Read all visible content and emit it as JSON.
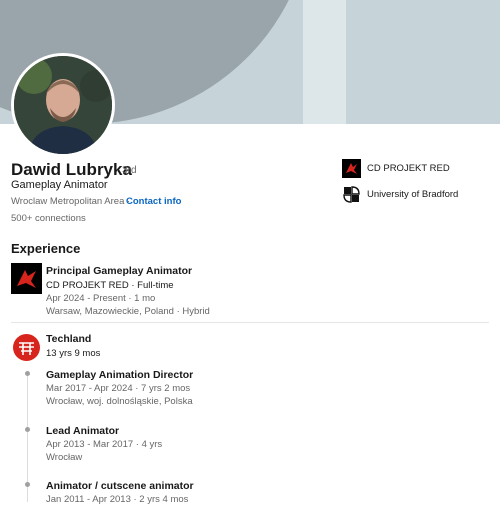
{
  "profile": {
    "name": "Dawid Lubryka",
    "degree": "· 3rd",
    "headline": "Gameplay Animator",
    "location": "Wroclaw Metropolitan Area ·",
    "contact_label": "Contact info",
    "connections": "500+ connections"
  },
  "affiliations": [
    {
      "name": "CD PROJEKT RED",
      "icon": "cdpr-logo-icon"
    },
    {
      "name": "University of Bradford",
      "icon": "university-logo-icon"
    }
  ],
  "experience": {
    "title": "Experience",
    "jobs": [
      {
        "role": "Principal Gameplay Animator",
        "company": "CD PROJEKT RED · Full-time",
        "dates": "Apr 2024 - Present · 1 mo",
        "location": "Warsaw, Mazowieckie, Poland · Hybrid"
      }
    ],
    "groups": [
      {
        "company": "Techland",
        "duration": "13 yrs 9 mos",
        "roles": [
          {
            "title": "Gameplay Animation Director",
            "dates": "Mar 2017 - Apr 2024 · 7 yrs 2 mos",
            "location": "Wrocław, woj. dolnośląskie, Polska"
          },
          {
            "title": "Lead Animator",
            "dates": "Apr 2013 - Mar 2017 · 4 yrs",
            "location": "Wrocław"
          },
          {
            "title": "Animator / cutscene animator",
            "dates": "Jan 2011 - Apr 2013 · 2 yrs 4 mos"
          }
        ]
      }
    ]
  },
  "colors": {
    "link": "#0a66c2",
    "cdpr_red": "#d7251d",
    "techland_red": "#d7251d"
  }
}
